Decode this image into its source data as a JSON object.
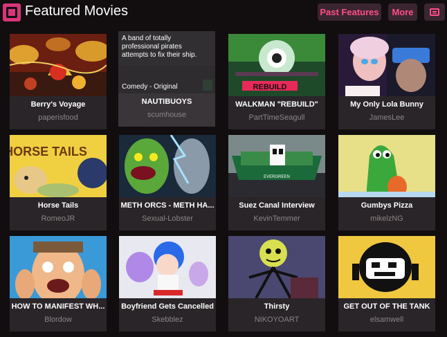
{
  "header": {
    "title": "Featured Movies",
    "past_features": "Past Features",
    "more": "More",
    "logo_icon": "newgrounds-film-icon",
    "menu_icon": "list-icon"
  },
  "colors": {
    "accent": "#ff4f86",
    "background": "#120d0f",
    "card": "#2a2528"
  },
  "movies": [
    {
      "title": "Berry's Voyage",
      "author": "paperisfood"
    },
    {
      "title": "NAUTIBUOYS",
      "author": "scumhouse",
      "description": "A band of totally professional pirates attempts to fix their ship.",
      "genre": "Comedy - Original"
    },
    {
      "title": "WALKMAN \"REBUILD\"",
      "author": "PartTimeSeagull",
      "thumb_text": "REBUILD"
    },
    {
      "title": "My Only Lola Bunny",
      "author": "JamesLee"
    },
    {
      "title": "Horse Tails",
      "author": "RomeoJR",
      "thumb_text": "HORSE TAILS"
    },
    {
      "title": "METH ORCS - METH HA...",
      "author": "Sexual-Lobster"
    },
    {
      "title": "Suez Canal Interview",
      "author": "KevinTemmer",
      "thumb_text": "EVERGREEN"
    },
    {
      "title": "Gumbys Pizza",
      "author": "mikelzNG"
    },
    {
      "title": "HOW TO MANIFEST WH...",
      "author": "Blordow"
    },
    {
      "title": "Boyfriend Gets Cancelled",
      "author": "Skebblez"
    },
    {
      "title": "Thirsty",
      "author": "NIKOYOART"
    },
    {
      "title": "GET OUT OF THE TANK",
      "author": "elsamwell"
    }
  ]
}
